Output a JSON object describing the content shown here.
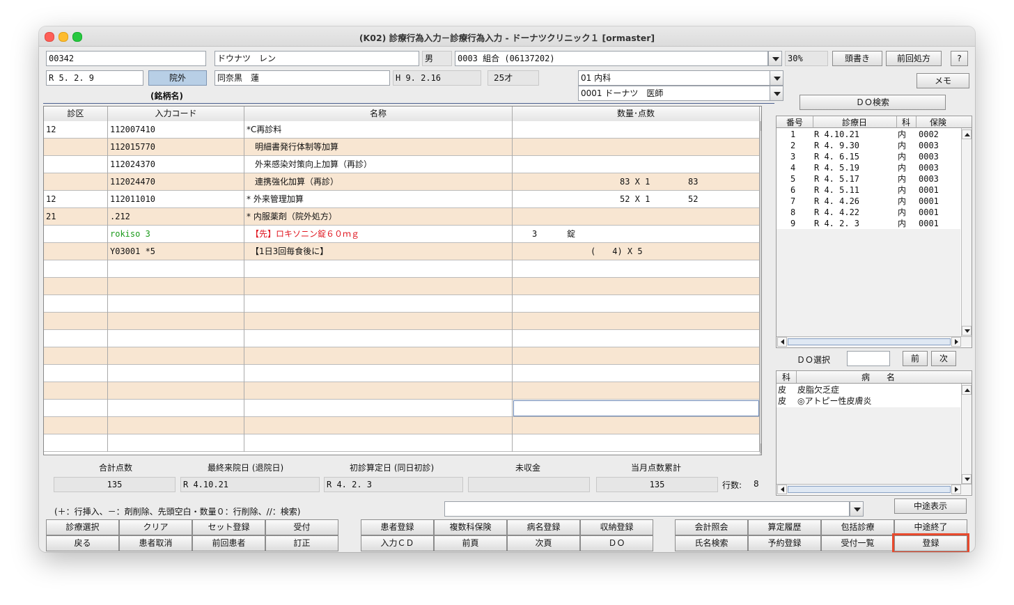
{
  "window": {
    "title": "(K02) 診療行為入力－診療行為入力 - ドーナツクリニック１ [ormaster]"
  },
  "patient": {
    "id": "00342",
    "kana_name": "ドウナツ　レン",
    "sex": "男",
    "insurance": "0003 組合 (06137202)",
    "ratio": "30%",
    "visit_date": "R 5. 2. 9",
    "visit_type": "院外",
    "kanji_name": "同奈黒　蓮",
    "birth_date": "H 9. 2.16",
    "age": "25才",
    "department": "01 内科",
    "doctor": "0001 ドーナツ　医師",
    "brand_label": "(銘柄名)"
  },
  "header_buttons": {
    "heading": "頭書き",
    "prev_rx": "前回処方",
    "help": "?",
    "memo": "メモ",
    "do_search": "ＤＯ検索"
  },
  "grid": {
    "columns": [
      "診区",
      "入力コード",
      "名称",
      "数量･点数"
    ],
    "rows": [
      {
        "kubun": "12",
        "code": "112007410",
        "name": "*C再診料",
        "qty": ""
      },
      {
        "kubun": "",
        "code": "112015770",
        "name": "　明細書発行体制等加算",
        "qty": ""
      },
      {
        "kubun": "",
        "code": "112024370",
        "name": "　外来感染対策向上加算（再診）",
        "qty": ""
      },
      {
        "kubun": "",
        "code": "112024470",
        "name": "　連携強化加算（再診）",
        "qty": "83 X 1",
        "pts": "83"
      },
      {
        "kubun": "12",
        "code": "112011010",
        "name": "* 外来管理加算",
        "qty": "52 X 1",
        "pts": "52"
      },
      {
        "kubun": "21",
        "code": ".212",
        "name": "* 内服薬剤（院外処方）",
        "qty": ""
      },
      {
        "kubun": "",
        "code": "rokiso 3",
        "name": "　【先】ロキソニン錠６０ｍｇ",
        "qty": "3",
        "unit": "錠"
      },
      {
        "kubun": "",
        "code": "Y03001 *5",
        "name": "　【1日3回毎食後に】",
        "qty": "(　　4) X 5"
      }
    ]
  },
  "summary": {
    "labels": {
      "total": "合計点数",
      "last_visit": "最終来院日 (退院日)",
      "first_exam": "初診算定日 (同日初診)",
      "unpaid": "未収金",
      "month_total": "当月点数累計",
      "row_count": "行数:"
    },
    "total": "135",
    "last_visit": "R 4.10.21",
    "first_exam": "R 4. 2. 3",
    "unpaid": "",
    "month_total": "135",
    "row_count": "8"
  },
  "history": {
    "columns": [
      "番号",
      "診療日",
      "科",
      "保険"
    ],
    "rows": [
      {
        "no": "1",
        "date": "R 4.10.21",
        "ka": "内",
        "ins": "0002"
      },
      {
        "no": "2",
        "date": "R 4. 9.30",
        "ka": "内",
        "ins": "0003"
      },
      {
        "no": "3",
        "date": "R 4. 6.15",
        "ka": "内",
        "ins": "0003"
      },
      {
        "no": "4",
        "date": "R 4. 5.19",
        "ka": "内",
        "ins": "0003"
      },
      {
        "no": "5",
        "date": "R 4. 5.17",
        "ka": "内",
        "ins": "0003"
      },
      {
        "no": "6",
        "date": "R 4. 5.11",
        "ka": "内",
        "ins": "0001"
      },
      {
        "no": "7",
        "date": "R 4. 4.26",
        "ka": "内",
        "ins": "0001"
      },
      {
        "no": "8",
        "date": "R 4. 4.22",
        "ka": "内",
        "ins": "0001"
      },
      {
        "no": "9",
        "date": "R 4. 2. 3",
        "ka": "内",
        "ins": "0001"
      }
    ]
  },
  "do_select": {
    "label": "ＤＯ選択",
    "prev": "前",
    "next": "次"
  },
  "disease": {
    "columns": [
      "科",
      "病　　名"
    ],
    "rows": [
      {
        "ka": "皮",
        "name": "皮脂欠乏症"
      },
      {
        "ka": "皮",
        "name": "◎アトピー性皮膚炎"
      }
    ]
  },
  "hint": "(＋：行挿入、－：剤削除、先頭空白・数量０：行削除、//：検索)",
  "midway_view": "中途表示",
  "footer": {
    "row1_left": [
      "診療選択",
      "クリア",
      "セット登録",
      "受付"
    ],
    "row2_left": [
      "戻る",
      "患者取消",
      "前回患者",
      "訂正"
    ],
    "row1_mid": [
      "患者登録",
      "複数科保険",
      "病名登録",
      "収納登録"
    ],
    "row2_mid": [
      "入力ＣＤ",
      "前頁",
      "次頁",
      "ＤＯ"
    ],
    "row1_right": [
      "会計照会",
      "算定履歴",
      "包括診療",
      "中途終了"
    ],
    "row2_right": [
      "氏名検索",
      "予約登録",
      "受付一覧",
      "登録"
    ]
  },
  "colors": {
    "row_alt": "#f8e6d2",
    "green_code": "#1a9a1a",
    "red_name": "#e0141e",
    "highlight": "#e8492c",
    "btn_blue": "#b8cfe6"
  }
}
